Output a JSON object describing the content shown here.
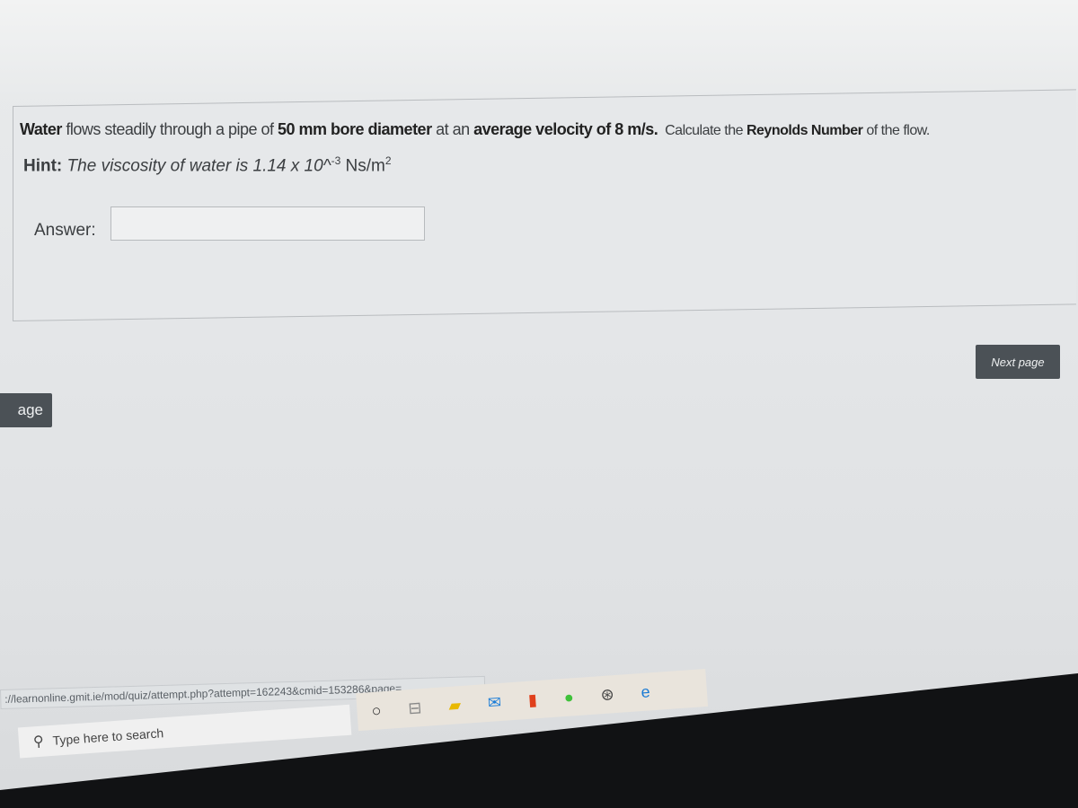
{
  "question": {
    "parts": [
      {
        "text": "Water",
        "bold": true
      },
      {
        "text": " flows steadily through a pipe of ",
        "bold": false
      },
      {
        "text": "50 mm bore diameter",
        "bold": true
      },
      {
        "text": " at an ",
        "bold": false
      },
      {
        "text": "average velocity of 8 m/s.",
        "bold": true
      },
      {
        "text": "  Calculate the ",
        "bold": false
      },
      {
        "text": "Reynolds Number",
        "bold": true
      },
      {
        "text": " of the flow.",
        "bold": false
      }
    ],
    "hint_label": "Hint:",
    "hint_text": "The viscosity of water is 1.14 x 10^",
    "hint_exp": "-3",
    "hint_unit": " Ns/m",
    "hint_unit_exp": "2"
  },
  "answer": {
    "label": "Answer:",
    "value": ""
  },
  "nav": {
    "next_label": "Next page",
    "prev_label": "age"
  },
  "browser": {
    "status_url": "://learnonline.gmit.ie/mod/quiz/attempt.php?attempt=162243&cmid=153286&page=..."
  },
  "taskbar": {
    "search_placeholder": "Type here to search",
    "icons": [
      "cortana-icon",
      "task-view-icon",
      "file-explorer-icon",
      "mail-icon",
      "office-icon",
      "xbox-companion-icon",
      "xbox-icon",
      "edge-icon"
    ]
  }
}
